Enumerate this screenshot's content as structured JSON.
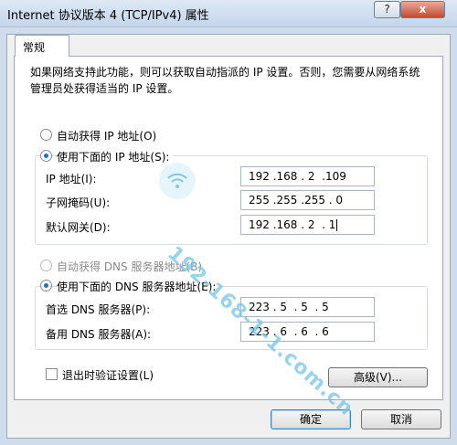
{
  "window": {
    "title": "Internet 协议版本 4 (TCP/IPv4) 属性",
    "help_label": "?",
    "close_label": "x"
  },
  "tabs": [
    {
      "label": "常规"
    }
  ],
  "description": "如果网络支持此功能，则可以获取自动指派的 IP 设置。否则，您需要从网络系统管理员处获得适当的 IP 设置。",
  "ip_section": {
    "auto_label": "自动获得 IP 地址(O)",
    "manual_label": "使用下面的 IP 地址(S):",
    "selected": "manual",
    "fields": [
      {
        "label": "IP 地址(I):",
        "value": "192 .168 . 2  .109"
      },
      {
        "label": "子网掩码(U):",
        "value": "255 .255 .255 . 0"
      },
      {
        "label": "默认网关(D):",
        "value": "192 .168 . 2  . 1"
      }
    ]
  },
  "dns_section": {
    "auto_label": "自动获得 DNS 服务器地址(B)",
    "auto_disabled": true,
    "manual_label": "使用下面的 DNS 服务器地址(E):",
    "selected": "manual",
    "fields": [
      {
        "label": "首选 DNS 服务器(P):",
        "value": "223 . 5  . 5  . 5"
      },
      {
        "label": "备用 DNS 服务器(A):",
        "value": "223 . 6  . 6  . 6"
      }
    ]
  },
  "validate": {
    "label": "退出时验证设置(L)",
    "checked": false
  },
  "advanced_label": "高级(V)...",
  "ok_label": "确定",
  "cancel_label": "取消",
  "watermark": "192-168-1-1.com.cn",
  "colors": {
    "accent": "#1f6fc0",
    "titlebar": "#c4d5ea",
    "close": "#c24a33",
    "watermark": "#78c3e6"
  }
}
